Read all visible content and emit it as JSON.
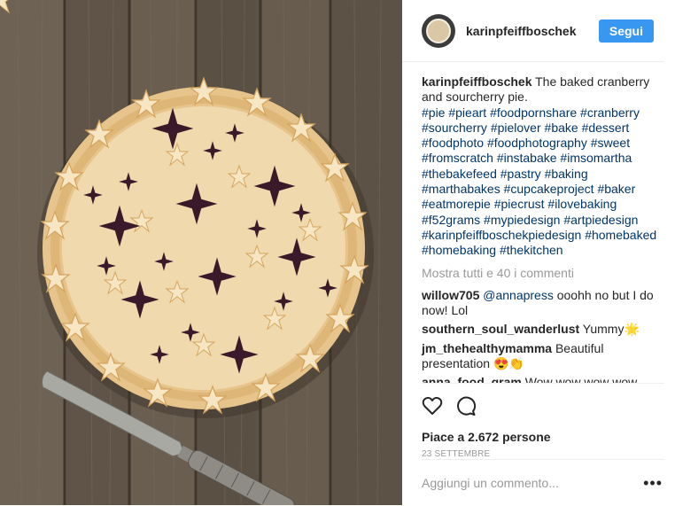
{
  "header": {
    "username": "karinpfeiffboschek",
    "follow_label": "Segui"
  },
  "caption": {
    "username": "karinpfeiffboschek",
    "text": "The baked cranberry and sourcherry pie.",
    "hashtags": [
      "#pie",
      "#pieart",
      "#foodpornshare",
      "#cranberry",
      "#sourcherry",
      "#pielover",
      "#bake",
      "#dessert",
      "#foodphoto",
      "#foodphotography",
      "#sweet",
      "#fromscratch",
      "#instabake",
      "#imsomartha",
      "#thebakefeed",
      "#pastry",
      "#baking",
      "#marthabakes",
      "#cupcakeproject",
      "#baker",
      "#eatmorepie",
      "#piecrust",
      "#ilovebaking",
      "#f52grams",
      "#mypiedesign",
      "#artpiedesign",
      "#karinpfeiffboschekpiedesign",
      "#homebaked",
      "#homebaking",
      "#thekitchen"
    ]
  },
  "view_all": "Mostra tutti e 40 i commenti",
  "comments": [
    {
      "user": "willow705",
      "mention": "@annapress",
      "text": "ooohh no but I do now! Lol"
    },
    {
      "user": "southern_soul_wanderlust",
      "text": "Yummy🌟"
    },
    {
      "user": "jm_thehealthymamma",
      "text": "Beautiful presentation 😍👏"
    },
    {
      "user": "anna_food_gram",
      "text": "Wow wow wow wow"
    }
  ],
  "likes": "Piace a 2.672 persone",
  "date": "23 SETTEMBRE",
  "add_comment_placeholder": "Aggiungi un commento...",
  "more_options": "•••",
  "icons": {
    "like": "heart-icon",
    "comment": "comment-bubble-icon",
    "more": "more-options-icon"
  },
  "colors": {
    "accent": "#3897f0",
    "hashtag": "#003569",
    "muted": "#999999",
    "text": "#262626"
  }
}
